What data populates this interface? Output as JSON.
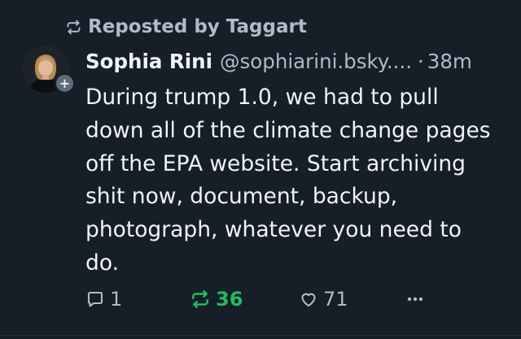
{
  "repost": {
    "icon": "repost-icon",
    "text": "Reposted by Taggart"
  },
  "author": {
    "display_name": "Sophia Rini",
    "handle": "@sophiarini.bsky....",
    "separator": "·",
    "time": "38m",
    "avatar": "avatar-photo",
    "follow_icon": "+"
  },
  "post": {
    "text": "During trump 1.0, we had to pull down all of the climate change pages off the EPA website. Start archiving shit now, document, backup, photograph, whatever you need to do."
  },
  "actions": {
    "reply": {
      "icon": "reply-icon",
      "count": "1"
    },
    "repost": {
      "icon": "repost-icon",
      "count": "36",
      "active": true
    },
    "like": {
      "icon": "heart-icon",
      "count": "71"
    },
    "more": {
      "icon": "more-icon"
    }
  },
  "colors": {
    "background": "#161e27",
    "text": "#f1f3f5",
    "muted": "#aebbc9",
    "repost_active": "#20bc63"
  }
}
